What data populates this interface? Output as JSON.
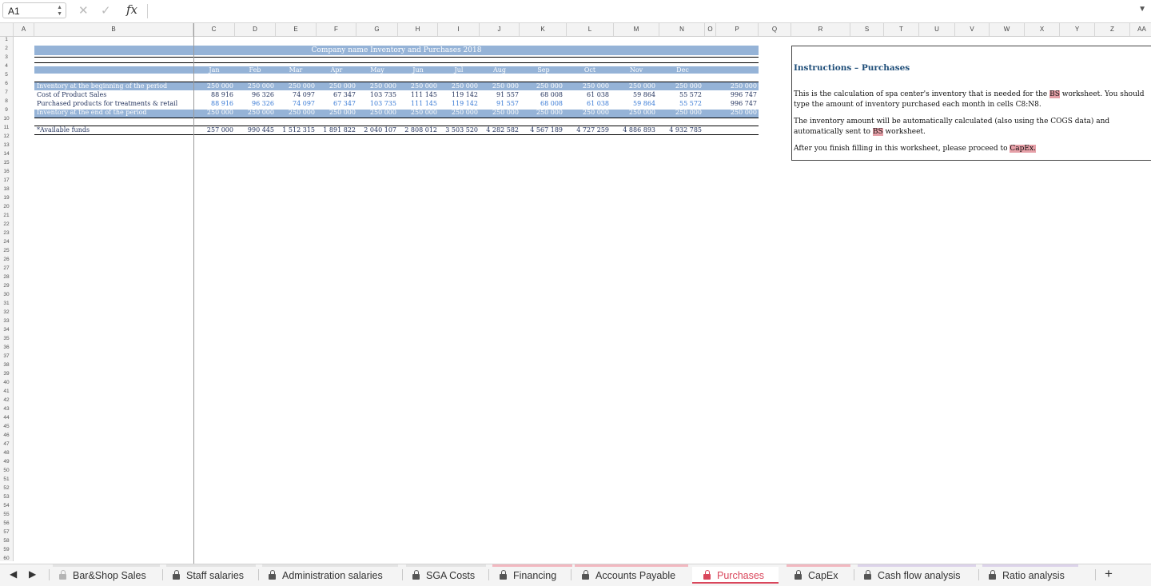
{
  "formula_bar": {
    "cell_ref": "A1",
    "fx": "fx",
    "value": ""
  },
  "columns": [
    "A",
    "B",
    "C",
    "D",
    "E",
    "F",
    "G",
    "H",
    "I",
    "J",
    "K",
    "L",
    "M",
    "N",
    "O",
    "P",
    "Q",
    "R",
    "S",
    "T",
    "U",
    "V",
    "W",
    "X",
    "Y",
    "Z",
    "AA"
  ],
  "sheet": {
    "title": "Company name Inventory and Purchases 2018",
    "months": [
      "Jan",
      "Feb",
      "Mar",
      "Apr",
      "May",
      "Jun",
      "Jul",
      "Aug",
      "Sep",
      "Oct",
      "Nov",
      "Dec"
    ],
    "rows": {
      "begin": {
        "label": "Inventory at the beginning of the period",
        "values": [
          "250 000",
          "250 000",
          "250 000",
          "250 000",
          "250 000",
          "250 000",
          "250 000",
          "250 000",
          "250 000",
          "250 000",
          "250 000",
          "250 000"
        ],
        "total": "250 000"
      },
      "cogs": {
        "label": "Cost of Product Sales",
        "values": [
          "88 916",
          "96 326",
          "74 097",
          "67 347",
          "103 735",
          "111 145",
          "119 142",
          "91 557",
          "68 008",
          "61 038",
          "59 864",
          "55 572"
        ],
        "total": "996 747"
      },
      "purchased": {
        "label": "Purchased products for treatments & retail",
        "values": [
          "88 916",
          "96 326",
          "74 097",
          "67 347",
          "103 735",
          "111 145",
          "119 142",
          "91 557",
          "68 008",
          "61 038",
          "59 864",
          "55 572"
        ],
        "total": "996 747"
      },
      "end": {
        "label": "Inventory at the end of the period",
        "values": [
          "250 000",
          "250 000",
          "250 000",
          "250 000",
          "250 000",
          "250 000",
          "250 000",
          "250 000",
          "250 000",
          "250 000",
          "250 000",
          "250 000"
        ],
        "total": "250 000"
      },
      "funds": {
        "label": "*Available funds",
        "values": [
          "257 000",
          "990 445",
          "1 512 315",
          "1 891 822",
          "2 040 107",
          "2 808 012",
          "3 503 520",
          "4 282 582",
          "4 567 189",
          "4 727 259",
          "4 886 893",
          "4 932 785"
        ]
      }
    }
  },
  "instructions": {
    "title": "Instructions – Purchases",
    "p1_a": "This is the calculation of spa center's inventory that is needed for the ",
    "p1_link": "BS",
    "p1_b": " worksheet. You should type the amount of inventory purchased each month in cells C8:N8.",
    "p2_a": "The inventory amount will be automatically calculated (also using the COGS data) and automatically sent to ",
    "p2_link": "BS",
    "p2_b": " worksheet.",
    "p3_a": "After you finish filling in this worksheet, please proceed to ",
    "p3_link": "CapEx."
  },
  "tabs": [
    {
      "label": "Bar&Shop Sales",
      "active": false
    },
    {
      "label": "Staff salaries",
      "active": false
    },
    {
      "label": "Administration salaries",
      "active": false
    },
    {
      "label": "SGA Costs",
      "active": false
    },
    {
      "label": "Financing",
      "active": false
    },
    {
      "label": "Accounts Payable",
      "active": false
    },
    {
      "label": "Purchases",
      "active": true
    },
    {
      "label": "CapEx",
      "active": false
    },
    {
      "label": "Cash flow analysis",
      "active": false
    },
    {
      "label": "Ratio analysis",
      "active": false
    }
  ],
  "add_tab": "+"
}
